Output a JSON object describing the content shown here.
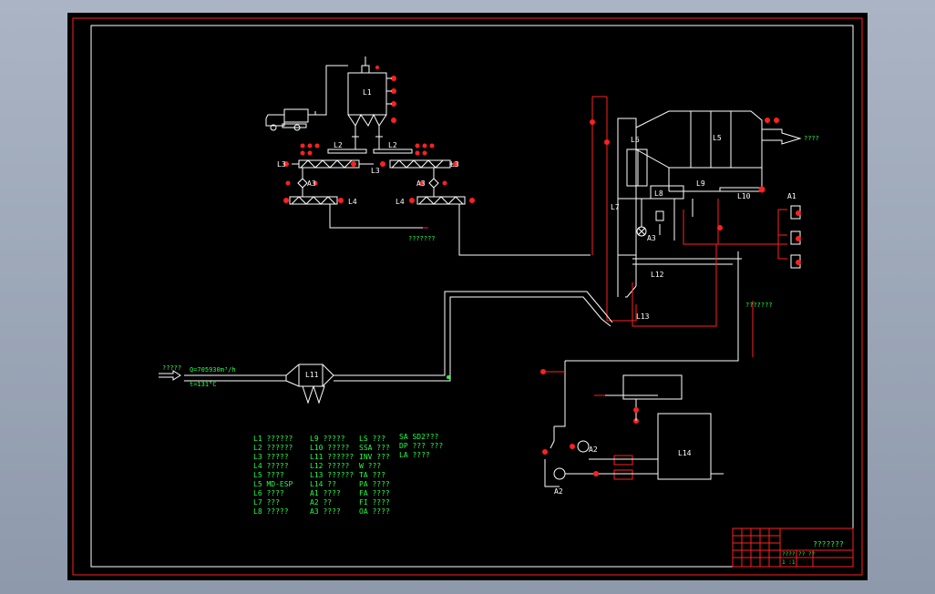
{
  "labels": {
    "L1": "L1",
    "L2a": "L2",
    "L2b": "L2",
    "L3a": "L3",
    "L3b": "L3",
    "L3c": "L3",
    "A3a": "A3",
    "A3b": "A3",
    "A3c": "A3",
    "L4a": "L4",
    "L4b": "L4",
    "L5": "L5",
    "L6": "L6",
    "L7": "L7",
    "L8": "L8",
    "L9": "L9",
    "L10": "L10",
    "L11": "L11",
    "L12": "L12",
    "L13": "L13",
    "L14": "L14",
    "A1": "A1",
    "A2a": "A2",
    "A2b": "A2",
    "outlet": "????",
    "ash_out": "???????",
    "inlet_top": "?????",
    "flow": "Q=705930m³/h",
    "temp": "t=131°C",
    "stack": "???????"
  },
  "legend": {
    "col1": [
      "L1 ??????",
      "L2 ??????",
      "L3 ?????",
      "L4 ?????",
      "L5 ????",
      "L5 MD-ESP",
      "L6 ????",
      "L7 ???",
      "L8 ?????"
    ],
    "col2": [
      "L9 ?????",
      "L10 ?????",
      "L11 ??????",
      "L12 ?????",
      "L13 ??????",
      "L14 ??",
      "A1 ????",
      "A2 ??",
      "A3 ????"
    ],
    "col3": [
      "LS ???",
      "SSA ???",
      "INV ???",
      "W ???",
      "TA ???",
      "PA ????",
      "FA ????",
      "FI ????",
      "OA ????"
    ],
    "col4": [
      "SA SD2???",
      "DP ??? ???",
      "LA ????"
    ]
  },
  "title_block": {
    "name": "???????",
    "cells": [
      "????",
      "?? ??",
      "1 :1"
    ]
  }
}
